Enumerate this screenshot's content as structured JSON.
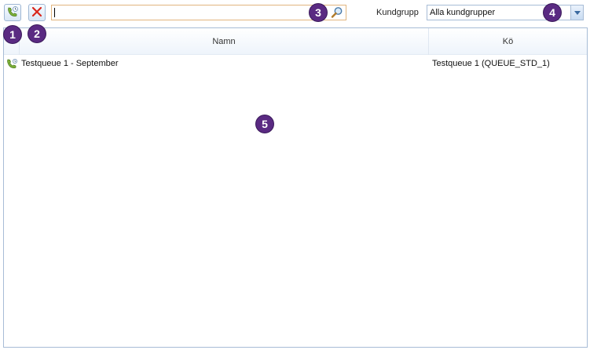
{
  "toolbar": {
    "add_call_icon": "phone-add-icon",
    "delete_icon": "red-x-icon",
    "search": {
      "value": "",
      "placeholder": ""
    },
    "customer_group_label": "Kundgrupp",
    "customer_group_selected": "Alla kundgrupper"
  },
  "markers": [
    "1",
    "2",
    "3",
    "4",
    "5"
  ],
  "grid": {
    "columns": [
      "Namn",
      "Kö"
    ],
    "rows": [
      {
        "icon": "phone-icon",
        "name": "Testqueue 1 - September",
        "queue": "Testqueue 1 (QUEUE_STD_1)"
      }
    ]
  },
  "colors": {
    "marker": "#5a2a82",
    "search_border": "#e2b57f",
    "grid_border": "#a7bcd6",
    "delete_red": "#d9261c"
  }
}
